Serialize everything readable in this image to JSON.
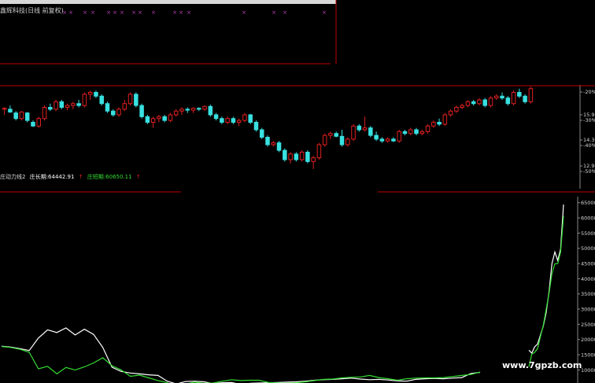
{
  "header": {
    "title": "鑫辉科技(日线 前复权)"
  },
  "indicator": {
    "line1_label": "庄动力线2",
    "line2_label": "庄长期:64442.91",
    "line3_label": "庄短期:60650.11",
    "arrow": "↑"
  },
  "price_axis": {
    "labels": [
      "-20%",
      "15.95",
      "-30%",
      "14.36",
      "-40%",
      "12.92",
      "-50%"
    ]
  },
  "indicator_axis": {
    "labels": [
      "65000",
      "60000",
      "55000",
      "50000",
      "45000",
      "40000",
      "35000",
      "30000",
      "25000",
      "20000",
      "15000",
      "10000"
    ]
  },
  "watermark": "www.7gpzb.com",
  "colors": {
    "up": "#e02020",
    "down": "#39e0e0",
    "line_long": "#ffffff",
    "line_short": "#33dd33",
    "separator": "#c00000",
    "marker": "#c040c0"
  },
  "chart_data": [
    {
      "type": "candlestick",
      "title": "鑫辉科技(日线 前复权)",
      "y_ticks": [
        15.95,
        14.36,
        12.92
      ],
      "percent_ticks": [
        "-20%",
        "-30%",
        "-40%",
        "-50%"
      ],
      "ylim": [
        12.5,
        17.3
      ],
      "candles": [
        [
          16.0,
          16.1,
          15.7,
          16.05
        ],
        [
          16.0,
          16.2,
          15.8,
          15.85
        ],
        [
          15.8,
          15.9,
          15.4,
          15.5
        ],
        [
          15.5,
          15.9,
          15.4,
          15.85
        ],
        [
          15.8,
          15.85,
          15.3,
          15.4
        ],
        [
          15.3,
          15.4,
          15.05,
          15.1
        ],
        [
          15.1,
          15.6,
          15.0,
          15.5
        ],
        [
          15.5,
          16.2,
          15.4,
          16.1
        ],
        [
          16.1,
          16.3,
          15.9,
          16.0
        ],
        [
          16.0,
          16.5,
          15.9,
          16.4
        ],
        [
          16.4,
          16.5,
          16.0,
          16.1
        ],
        [
          16.1,
          16.3,
          15.95,
          16.2
        ],
        [
          16.2,
          16.4,
          16.0,
          16.3
        ],
        [
          16.3,
          16.5,
          16.1,
          16.2
        ],
        [
          16.2,
          16.9,
          16.1,
          16.8
        ],
        [
          16.8,
          17.0,
          16.5,
          16.9
        ],
        [
          16.9,
          17.0,
          16.6,
          16.7
        ],
        [
          16.7,
          16.8,
          16.2,
          16.3
        ],
        [
          16.3,
          16.4,
          15.8,
          15.9
        ],
        [
          15.9,
          16.0,
          15.6,
          15.7
        ],
        [
          15.7,
          16.1,
          15.6,
          16.0
        ],
        [
          16.0,
          16.5,
          15.9,
          16.3
        ],
        [
          16.3,
          16.9,
          16.2,
          16.8
        ],
        [
          16.8,
          16.9,
          16.1,
          16.2
        ],
        [
          16.2,
          16.3,
          15.5,
          15.6
        ],
        [
          15.6,
          15.7,
          15.2,
          15.3
        ],
        [
          15.3,
          15.6,
          15.0,
          15.5
        ],
        [
          15.5,
          15.7,
          15.3,
          15.6
        ],
        [
          15.6,
          15.7,
          15.3,
          15.4
        ],
        [
          15.4,
          15.8,
          15.3,
          15.7
        ],
        [
          15.7,
          16.0,
          15.6,
          15.9
        ],
        [
          15.9,
          16.1,
          15.7,
          16.0
        ],
        [
          16.0,
          16.1,
          15.8,
          15.95
        ],
        [
          15.95,
          16.1,
          15.8,
          16.05
        ],
        [
          16.05,
          16.1,
          15.9,
          16.0
        ],
        [
          16.0,
          16.2,
          15.9,
          16.15
        ],
        [
          16.15,
          16.25,
          15.6,
          15.7
        ],
        [
          15.7,
          15.8,
          15.4,
          15.5
        ],
        [
          15.5,
          15.6,
          15.2,
          15.3
        ],
        [
          15.3,
          15.6,
          15.2,
          15.5
        ],
        [
          15.5,
          15.6,
          15.2,
          15.3
        ],
        [
          15.3,
          15.5,
          15.1,
          15.4
        ],
        [
          15.4,
          15.8,
          15.3,
          15.7
        ],
        [
          15.7,
          15.75,
          15.2,
          15.3
        ],
        [
          15.3,
          15.4,
          14.8,
          14.9
        ],
        [
          14.9,
          15.0,
          14.4,
          14.5
        ],
        [
          14.5,
          14.6,
          14.0,
          14.1
        ],
        [
          14.1,
          14.3,
          14.0,
          14.2
        ],
        [
          14.2,
          14.3,
          13.7,
          13.8
        ],
        [
          13.8,
          13.9,
          13.2,
          13.3
        ],
        [
          13.3,
          13.7,
          13.1,
          13.6
        ],
        [
          13.6,
          13.7,
          13.2,
          13.3
        ],
        [
          13.3,
          13.8,
          13.2,
          13.7
        ],
        [
          13.7,
          13.8,
          13.1,
          13.2
        ],
        [
          13.2,
          13.5,
          12.8,
          13.4
        ],
        [
          13.4,
          14.2,
          13.3,
          14.1
        ],
        [
          14.1,
          14.7,
          14.0,
          14.6
        ],
        [
          14.6,
          14.8,
          14.4,
          14.7
        ],
        [
          14.7,
          14.8,
          14.5,
          14.55
        ],
        [
          14.55,
          14.9,
          14.0,
          14.1
        ],
        [
          14.1,
          14.5,
          14.0,
          14.4
        ],
        [
          14.4,
          15.2,
          14.3,
          15.1
        ],
        [
          15.1,
          15.2,
          14.8,
          14.9
        ],
        [
          14.9,
          15.6,
          14.8,
          15.0
        ],
        [
          15.0,
          15.1,
          14.5,
          14.6
        ],
        [
          14.6,
          14.8,
          14.3,
          14.4
        ],
        [
          14.4,
          14.5,
          14.2,
          14.3
        ],
        [
          14.3,
          14.5,
          14.2,
          14.4
        ],
        [
          14.4,
          14.5,
          14.25,
          14.3
        ],
        [
          14.3,
          14.9,
          14.2,
          14.8
        ],
        [
          14.8,
          14.9,
          14.6,
          14.7
        ],
        [
          14.7,
          15.0,
          14.6,
          14.9
        ],
        [
          14.9,
          15.0,
          14.6,
          14.7
        ],
        [
          14.7,
          14.9,
          14.6,
          14.8
        ],
        [
          14.8,
          15.2,
          14.7,
          15.1
        ],
        [
          15.1,
          15.4,
          15.0,
          15.3
        ],
        [
          15.3,
          15.5,
          15.1,
          15.2
        ],
        [
          15.2,
          15.8,
          15.1,
          15.7
        ],
        [
          15.7,
          16.0,
          15.6,
          15.9
        ],
        [
          15.9,
          16.2,
          15.8,
          16.1
        ],
        [
          16.1,
          16.3,
          16.0,
          16.2
        ],
        [
          16.2,
          16.5,
          16.1,
          16.4
        ],
        [
          16.4,
          16.5,
          16.2,
          16.3
        ],
        [
          16.3,
          16.6,
          16.2,
          16.5
        ],
        [
          16.5,
          16.6,
          16.1,
          16.2
        ],
        [
          16.2,
          16.7,
          16.1,
          16.6
        ],
        [
          16.6,
          16.8,
          16.5,
          16.7
        ],
        [
          16.7,
          16.9,
          16.5,
          16.6
        ],
        [
          16.6,
          16.7,
          16.2,
          16.3
        ],
        [
          16.3,
          17.0,
          16.2,
          16.9
        ],
        [
          16.9,
          17.1,
          16.6,
          16.7
        ],
        [
          16.7,
          16.8,
          16.3,
          16.4
        ],
        [
          16.4,
          17.2,
          16.3,
          17.1
        ]
      ]
    },
    {
      "type": "line",
      "series": [
        {
          "name": "庄长期",
          "values": [
            17800,
            17500,
            17000,
            16400,
            20500,
            23200,
            22300,
            23800,
            21500,
            23400,
            21700,
            17400,
            10900,
            9500,
            9000,
            8700,
            8400,
            8200,
            6300,
            5400,
            6200,
            6300,
            6100,
            5500,
            5800,
            5900,
            5200,
            5600,
            5700,
            5800,
            5900,
            6000,
            6100,
            6300,
            6600,
            6800,
            6900,
            7100,
            7300,
            7000,
            6800,
            6900,
            6700,
            6400,
            6300,
            6900,
            7100,
            7200,
            7100,
            7300,
            7500,
            8800,
            9200,
            16500,
            15500,
            17600,
            18500,
            21500,
            24400,
            28900,
            36000,
            45000,
            48800,
            46000,
            49800,
            64400
          ]
        },
        {
          "name": "庄短期",
          "values": [
            17700,
            17400,
            16800,
            15800,
            10400,
            11200,
            8700,
            10800,
            10000,
            11000,
            12300,
            14000,
            11400,
            10000,
            7900,
            8300,
            7400,
            6500,
            5800,
            4000,
            5400,
            6000,
            5600,
            5700,
            6300,
            6800,
            6500,
            6600,
            6600,
            5900,
            5700,
            5600,
            5800,
            6100,
            6500,
            6900,
            7000,
            7400,
            7600,
            7700,
            8200,
            7500,
            7100,
            6600,
            7100,
            7300,
            7400,
            7400,
            7500,
            7800,
            8200,
            8500,
            9300,
            11000,
            15200,
            15800,
            17000,
            21000,
            24700,
            30000,
            35400,
            41700,
            44900,
            45000,
            48800,
            60650
          ]
        }
      ],
      "ylim": [
        7000,
        67000
      ],
      "y_ticks": [
        10000,
        15000,
        20000,
        25000,
        30000,
        35000,
        40000,
        45000,
        50000,
        55000,
        60000,
        65000
      ]
    }
  ]
}
